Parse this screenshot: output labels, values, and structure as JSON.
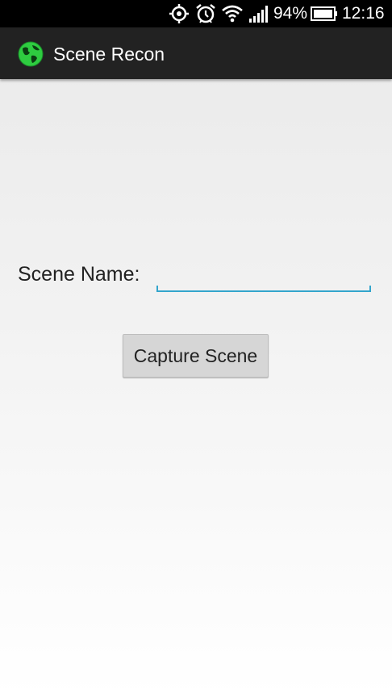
{
  "status_bar": {
    "battery_percent": "94%",
    "time": "12:16",
    "icons": [
      "gps-icon",
      "alarm-icon",
      "wifi-icon",
      "signal-icon",
      "battery-icon"
    ]
  },
  "action_bar": {
    "app_icon": "globe-icon",
    "title": "Scene Recon"
  },
  "form": {
    "scene_name_label": "Scene Name:",
    "scene_name_value": "",
    "accent_color": "#33a5cc"
  },
  "capture_button": {
    "label": "Capture Scene"
  }
}
